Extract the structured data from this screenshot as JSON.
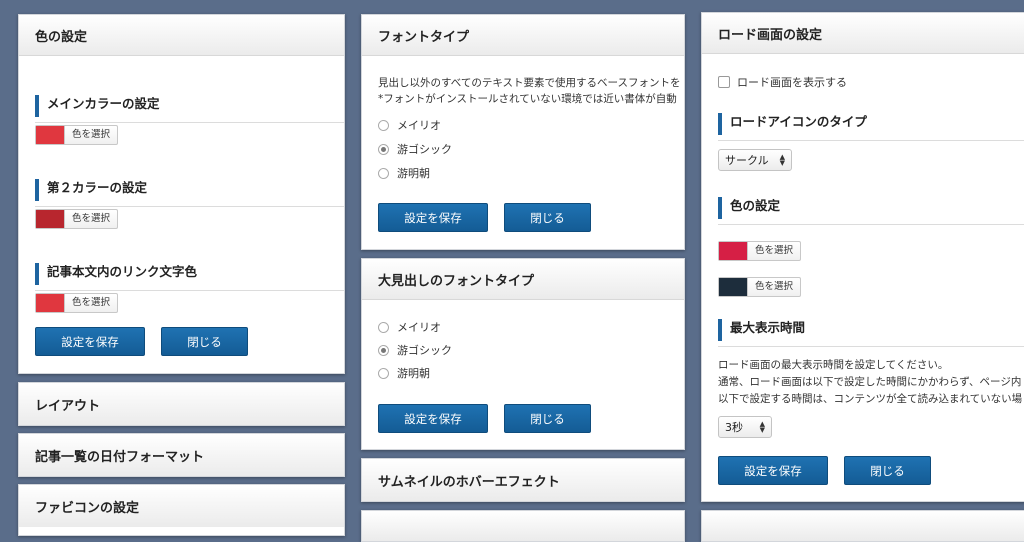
{
  "left": {
    "color_panel": {
      "title": "色の設定",
      "sections": [
        {
          "label": "メインカラーの設定",
          "pick_label": "色を選択",
          "color": "#e0373f"
        },
        {
          "label": "第２カラーの設定",
          "pick_label": "色を選択",
          "color": "#b8262e"
        },
        {
          "label": "記事本文内のリンク文字色",
          "pick_label": "色を選択",
          "color": "#e0373f"
        }
      ],
      "save_label": "設定を保存",
      "close_label": "閉じる"
    },
    "layout_title": "レイアウト",
    "date_format_title": "記事一覧の日付フォーマット",
    "favicon_title": "ファビコンの設定"
  },
  "middle": {
    "font_panel": {
      "title": "フォントタイプ",
      "desc_line1": "見出し以外のすべてのテキスト要素で使用するベースフォントを",
      "desc_line2": "*フォントがインストールされていない環境では近い書体が自動",
      "options": [
        "メイリオ",
        "游ゴシック",
        "游明朝"
      ],
      "selected": 1,
      "save_label": "設定を保存",
      "close_label": "閉じる"
    },
    "heading_font_panel": {
      "title": "大見出しのフォントタイプ",
      "options": [
        "メイリオ",
        "游ゴシック",
        "游明朝"
      ],
      "selected": 1,
      "save_label": "設定を保存",
      "close_label": "閉じる"
    },
    "thumb_hover_title": "サムネイルのホバーエフェクト"
  },
  "right": {
    "load_panel": {
      "title": "ロード画面の設定",
      "show_checkbox_label": "ロード画面を表示する",
      "show_checked": false,
      "icon_type_label": "ロードアイコンのタイプ",
      "icon_type_value": "サークル",
      "color_label": "色の設定",
      "colors": [
        {
          "pick_label": "色を選択",
          "color": "#d61f45"
        },
        {
          "pick_label": "色を選択",
          "color": "#1d2d3c"
        }
      ],
      "max_time_label": "最大表示時間",
      "desc_line1": "ロード画面の最大表示時間を設定してください。",
      "desc_line2": "通常、ロード画面は以下で設定した時間にかかわらず、ページ内",
      "desc_line3": "以下で設定する時間は、コンテンツが全て読み込まれていない場",
      "time_value": "3秒",
      "save_label": "設定を保存",
      "close_label": "閉じる"
    }
  }
}
